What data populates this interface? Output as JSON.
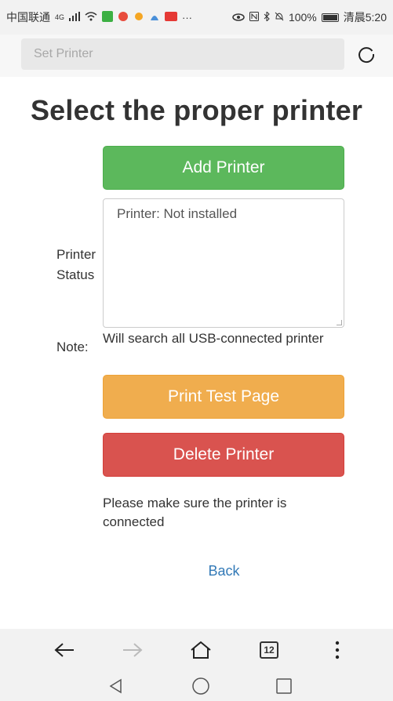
{
  "status_bar": {
    "carrier": "中国联通",
    "network": "4G",
    "battery": "100%",
    "time": "清晨5:20"
  },
  "address_bar": {
    "placeholder": "Set Printer"
  },
  "page": {
    "title": "Select the proper printer",
    "add_button": "Add Printer",
    "status_label": "Printer Status",
    "status_text": "Printer: Not installed",
    "note_label": "Note:",
    "note_text": "Will search all USB-connected printer",
    "test_button": "Print Test Page",
    "delete_button": "Delete Printer",
    "hint": "Please make sure the printer is connected",
    "back_link": "Back"
  },
  "toolbar": {
    "tab_count": "12"
  },
  "colors": {
    "success": "#5cb85c",
    "warning": "#f0ad4e",
    "danger": "#d9534f",
    "link": "#337ab7"
  }
}
